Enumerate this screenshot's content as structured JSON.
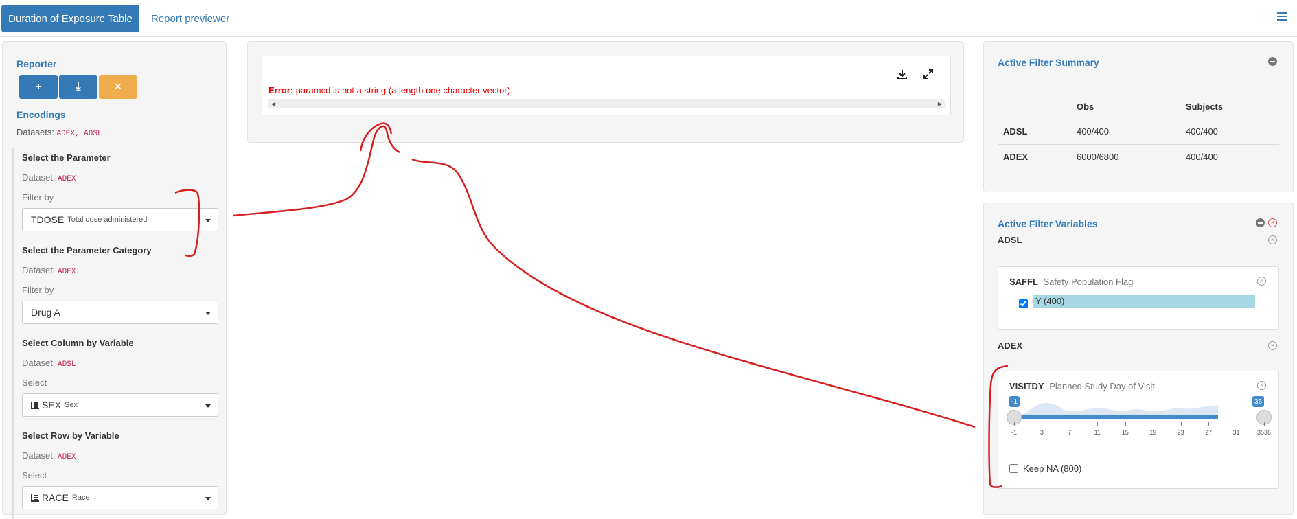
{
  "nav": {
    "active_tab": "Duration of Exposure Table",
    "tab2": "Report previewer"
  },
  "left": {
    "reporter_title": "Reporter",
    "btn_add": "+",
    "btn_download": "⤓",
    "btn_reset": "×",
    "encodings_title": "Encodings",
    "datasets_label": "Datasets:",
    "datasets_value": "ADEX, ADSL",
    "sections": [
      {
        "title": "Select the Parameter",
        "dataset_label": "Dataset:",
        "dataset": "ADEX",
        "filter_label": "Filter by",
        "value": "TDOSE",
        "sub": "Total dose administered"
      },
      {
        "title": "Select the Parameter Category",
        "dataset_label": "Dataset:",
        "dataset": "ADEX",
        "filter_label": "Filter by",
        "value": "Drug A",
        "sub": ""
      },
      {
        "title": "Select Column by Variable",
        "dataset_label": "Dataset:",
        "dataset": "ADSL",
        "filter_label": "Select",
        "value": "SEX",
        "sub": "Sex"
      },
      {
        "title": "Select Row by Variable",
        "dataset_label": "Dataset:",
        "dataset": "ADEX",
        "filter_label": "Select",
        "value": "RACE",
        "sub": "Race"
      }
    ]
  },
  "center": {
    "error_label": "Error:",
    "error_text": "paramcd is not a string (a length one character vector)."
  },
  "summary": {
    "title": "Active Filter Summary",
    "col_obs": "Obs",
    "col_subjects": "Subjects",
    "rows": [
      {
        "name": "ADSL",
        "obs": "400/400",
        "subjects": "400/400"
      },
      {
        "name": "ADEX",
        "obs": "6000/6800",
        "subjects": "400/400"
      }
    ]
  },
  "filters": {
    "title": "Active Filter Variables",
    "adsl_label": "ADSL",
    "saffl_name": "SAFFL",
    "saffl_desc": "Safety Population Flag",
    "saffl_option": "Y (400)",
    "adex_label": "ADEX",
    "visitdy_name": "VISITDY",
    "visitdy_desc": "Planned Study Day of Visit",
    "slider_min": "-1",
    "slider_max": "36",
    "ticks": [
      "-1",
      "3",
      "7",
      "11",
      "15",
      "19",
      "23",
      "27",
      "31",
      "3536"
    ],
    "keep_na": "Keep NA (800)"
  },
  "colors": {
    "primary": "#337ab7",
    "warning": "#f0ad4e",
    "error": "#e00000",
    "annotation": "#d62020"
  }
}
